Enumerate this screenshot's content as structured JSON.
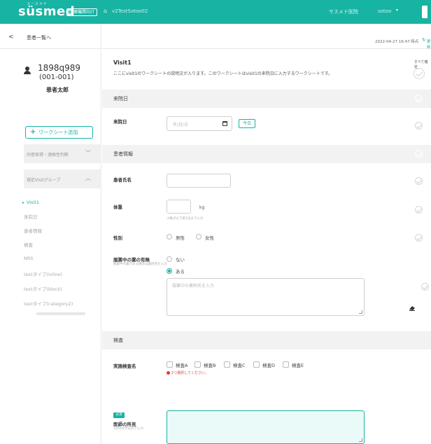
{
  "topbar": {
    "logo": "süsmed",
    "logo_small": "スースメド",
    "badge": "医療機関向け",
    "home_icon": "home-icon",
    "worksheet_title": "v2TestSotoo02",
    "facility": "サスメド医院",
    "user": "sotoo",
    "user_arrow": "▾"
  },
  "sidebar": {
    "back_label": "患者一覧へ",
    "patient_id": "1898q989",
    "patient_sub": "(001-001)",
    "patient_name": "患者太郎",
    "add_button": "ワークシート追加",
    "group1": "同意取得・適格性判断",
    "group2": "規定Visitグループ",
    "items": [
      {
        "label": "Visit1",
        "active": true
      },
      {
        "label": "来院日",
        "active": false
      },
      {
        "label": "患者情報",
        "active": false
      },
      {
        "label": "検査",
        "active": false
      },
      {
        "label": "NRS",
        "active": false
      },
      {
        "label": "textタイプ(inline)",
        "active": false
      },
      {
        "label": "textタイプ(block)",
        "active": false
      },
      {
        "label": "textタイプ(category2)",
        "active": false
      }
    ]
  },
  "main": {
    "timestamp": "2022-04-27 16:47 時点",
    "refresh_label": "更新",
    "visit_title": "Visit1",
    "visit_desc": "ここにvisit1のワークシートの説明文が入ります。このワークシートはvisit1の来院日に入力するワークシートです。",
    "all_done_label": "すべて確定",
    "sections": {
      "visit_date": "来院日",
      "patient_info": "患者情報",
      "test": "検査"
    },
    "visit_date_field": {
      "label": "来院日",
      "placeholder": "年/月/日",
      "today_button": "今日"
    },
    "name_field": {
      "label": "患者氏名",
      "value": ""
    },
    "weight_field": {
      "label": "体重",
      "unit": "kg",
      "hint": "小数点以下第1位まで入力"
    },
    "sex_field": {
      "label": "性別",
      "options": [
        "男性",
        "女性"
      ],
      "selected": null
    },
    "medication_field": {
      "label": "服薬中の薬の有無",
      "note": "服薬中の薬がある場合は薬剤名を入力",
      "options": [
        "ない",
        "ある"
      ],
      "selected": "ある",
      "textarea_placeholder": "服薬中の薬剤名を入力"
    },
    "test_field": {
      "label": "実施検査名",
      "options": [
        "検査A",
        "検査B",
        "検査C",
        "検査D",
        "検査E"
      ],
      "error": "2つ選択してください。"
    },
    "doctor_field": {
      "required_badge": "必須",
      "label": "医師の所見",
      "note": "1000文字以内で入力"
    },
    "colors": {
      "accent": "#17b3a3",
      "error": "#e53935",
      "section_bg": "#f2f2f2"
    }
  }
}
